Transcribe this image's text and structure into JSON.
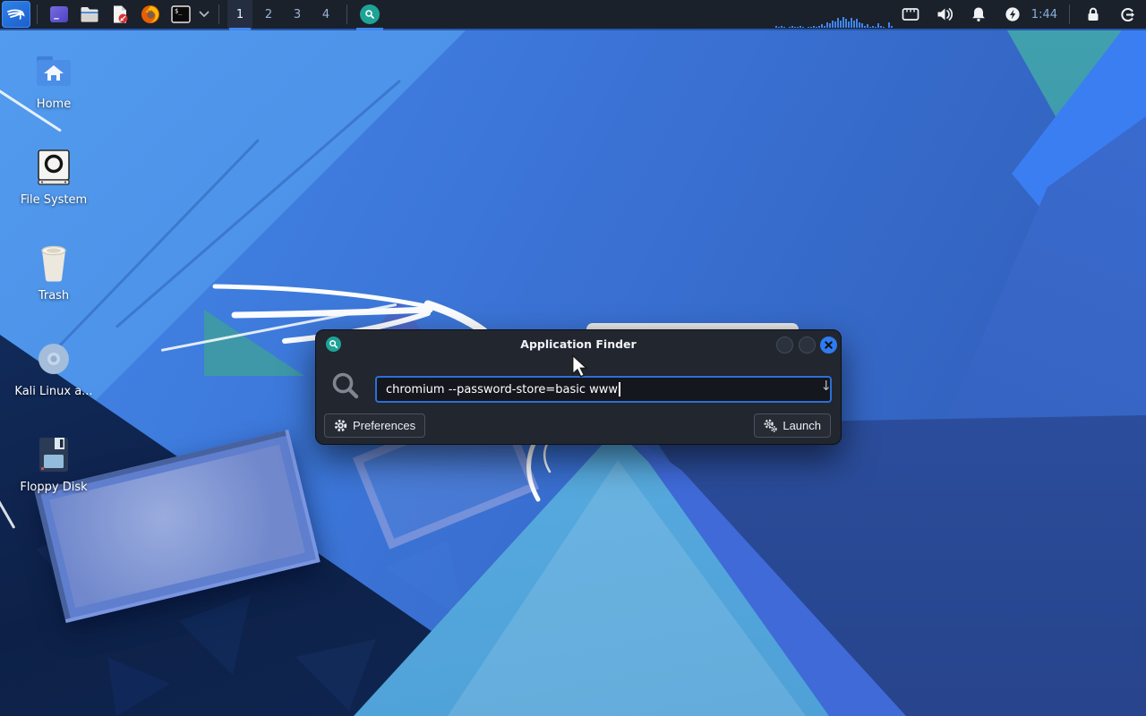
{
  "panel": {
    "kali_menu_icon": "kali-dragon-icon",
    "launcher_icons": [
      "window-icon",
      "file-manager-icon",
      "text-editor-icon",
      "firefox-icon",
      "terminal-icon",
      "chevron-down-icon"
    ],
    "terminal_glyph": "$_",
    "workspaces": [
      {
        "label": "1",
        "active": true
      },
      {
        "label": "2",
        "active": false
      },
      {
        "label": "3",
        "active": false
      },
      {
        "label": "4",
        "active": false
      }
    ],
    "taskbar": [
      {
        "name": "application-finder",
        "icon": "magnifier-icon",
        "active": true
      }
    ],
    "tray_icons": [
      "network-icon",
      "volume-icon",
      "notifications-bell-icon",
      "power-manager-icon",
      "lock-icon",
      "logout-icon"
    ],
    "clock": "1:44",
    "cpu_graph_bars": [
      2,
      1,
      2,
      1,
      0,
      1,
      2,
      1,
      1,
      2,
      1,
      0,
      1,
      1,
      2,
      1,
      2,
      3,
      2,
      5,
      4,
      7,
      6,
      9,
      7,
      10,
      8,
      6,
      9,
      7,
      8,
      5,
      4,
      2,
      3,
      1,
      2,
      1,
      4,
      2,
      1,
      0,
      5,
      2
    ]
  },
  "desktop": {
    "icons": [
      {
        "label": "Home",
        "icon": "home-folder-icon"
      },
      {
        "label": "File System",
        "icon": "drive-icon"
      },
      {
        "label": "Trash",
        "icon": "trash-icon"
      },
      {
        "label": "Kali Linux a...",
        "icon": "disc-icon"
      },
      {
        "label": "Floppy Disk",
        "icon": "floppy-icon"
      }
    ]
  },
  "app_finder": {
    "title": "Application Finder",
    "query": "chromium --password-store=basic www",
    "combo_arrow": "↓",
    "preferences_label": "Preferences",
    "launch_label": "Launch"
  },
  "colors": {
    "panel_bg": "#1b212b",
    "accent": "#3f86f0",
    "dialog_bg": "#22262f",
    "input_border": "#2d6fd8",
    "badge_teal": "#1fa396",
    "clock_text": "#8ab0d8"
  }
}
